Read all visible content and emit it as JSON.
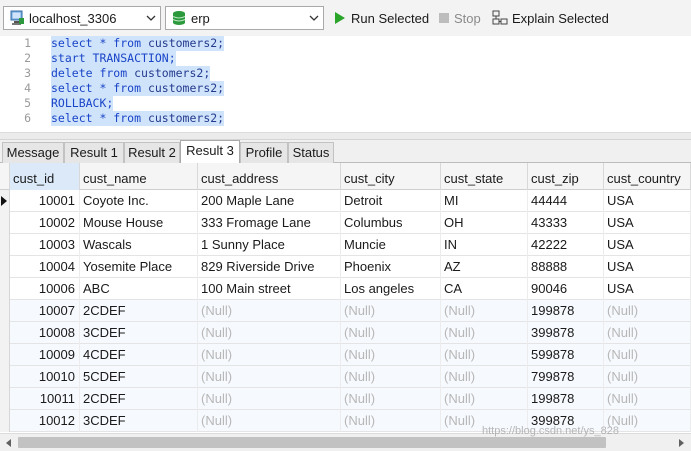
{
  "toolbar": {
    "connection": "localhost_3306",
    "database": "erp",
    "run_selected": "Run Selected",
    "stop": "Stop",
    "explain_selected": "Explain Selected"
  },
  "editor": {
    "lines": [
      {
        "num": "1",
        "kw": "select * from",
        "rest": " customers2;"
      },
      {
        "num": "2",
        "kw": "start TRANSACTION;",
        "rest": ""
      },
      {
        "num": "3",
        "kw": "delete from",
        "rest": " customers2;"
      },
      {
        "num": "4",
        "kw": "select * from",
        "rest": " customers2;"
      },
      {
        "num": "5",
        "kw": "ROLLBACK;",
        "rest": ""
      },
      {
        "num": "6",
        "kw": "select * from",
        "rest": " customers2;"
      }
    ]
  },
  "tabs": [
    "Message",
    "Result 1",
    "Result 2",
    "Result 3",
    "Profile",
    "Status"
  ],
  "active_tab": "Result 3",
  "grid": {
    "columns": [
      "cust_id",
      "cust_name",
      "cust_address",
      "cust_city",
      "cust_state",
      "cust_zip",
      "cust_country"
    ],
    "rows": [
      [
        "10001",
        "Coyote Inc.",
        "200 Maple Lane",
        "Detroit",
        "MI",
        "44444",
        "USA"
      ],
      [
        "10002",
        "Mouse House",
        "333 Fromage Lane",
        "Columbus",
        "OH",
        "43333",
        "USA"
      ],
      [
        "10003",
        "Wascals",
        "1 Sunny Place",
        "Muncie",
        "IN",
        "42222",
        "USA"
      ],
      [
        "10004",
        "Yosemite Place",
        "829 Riverside Drive",
        "Phoenix",
        "AZ",
        "88888",
        "USA"
      ],
      [
        "10006",
        "ABC",
        "100 Main street",
        "Los angeles",
        "CA",
        "90046",
        "USA"
      ],
      [
        "10007",
        "2CDEF",
        "(Null)",
        "(Null)",
        "(Null)",
        "199878",
        "(Null)"
      ],
      [
        "10008",
        "3CDEF",
        "(Null)",
        "(Null)",
        "(Null)",
        "399878",
        "(Null)"
      ],
      [
        "10009",
        "4CDEF",
        "(Null)",
        "(Null)",
        "(Null)",
        "599878",
        "(Null)"
      ],
      [
        "10010",
        "5CDEF",
        "(Null)",
        "(Null)",
        "(Null)",
        "799878",
        "(Null)"
      ],
      [
        "10011",
        "2CDEF",
        "(Null)",
        "(Null)",
        "(Null)",
        "199878",
        "(Null)"
      ],
      [
        "10012",
        "3CDEF",
        "(Null)",
        "(Null)",
        "(Null)",
        "399878",
        "(Null)"
      ]
    ]
  },
  "watermark": "https://blog.csdn.net/ys_828",
  "colors": {
    "selection": "#cfe4fb",
    "keyword": "#1a44c8",
    "run_green": "#2aa52a",
    "db_green": "#2c9a3c",
    "null_text": "#b7b7b7"
  }
}
